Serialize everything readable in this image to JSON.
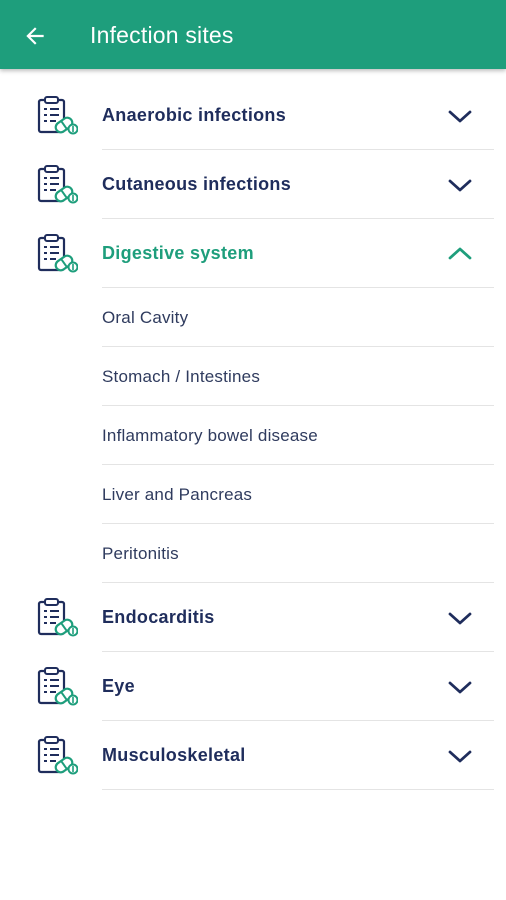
{
  "app_bar": {
    "title": "Infection sites",
    "back_icon": "arrow-left-icon",
    "background": "#1e9e7c"
  },
  "colors": {
    "primary": "#1e9e7c",
    "category_text": "#1f2d5c",
    "subitem_text": "#2f3b5e",
    "divider": "#e4e4e4"
  },
  "categories": [
    {
      "label": "Anaerobic infections",
      "icon": "clipboard-icon",
      "expanded": false,
      "children": []
    },
    {
      "label": "Cutaneous infections",
      "icon": "clipboard-icon",
      "expanded": false,
      "children": []
    },
    {
      "label": "Digestive system",
      "icon": "clipboard-icon",
      "expanded": true,
      "children": [
        "Oral Cavity",
        "Stomach / Intestines",
        "Inflammatory bowel disease",
        "Liver and Pancreas",
        "Peritonitis"
      ]
    },
    {
      "label": "Endocarditis",
      "icon": "clipboard-icon",
      "expanded": false,
      "children": []
    },
    {
      "label": "Eye",
      "icon": "clipboard-icon",
      "expanded": false,
      "children": []
    },
    {
      "label": "Musculoskeletal",
      "icon": "clipboard-icon",
      "expanded": false,
      "children": []
    }
  ]
}
